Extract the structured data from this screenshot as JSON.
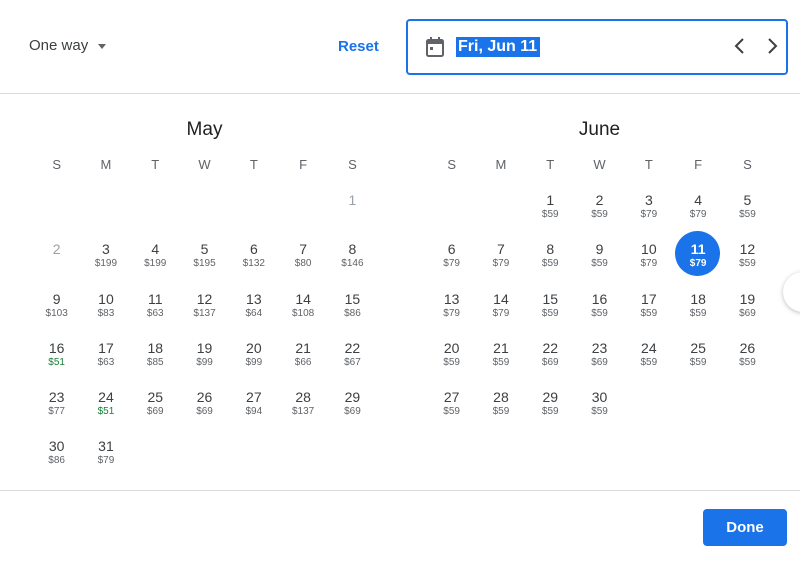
{
  "header": {
    "trip_type": "One way",
    "reset_label": "Reset",
    "selected_date": "Fri, Jun 11"
  },
  "weekdays": [
    "S",
    "M",
    "T",
    "W",
    "T",
    "F",
    "S"
  ],
  "months": [
    {
      "name": "May",
      "days": [
        {
          "day": "",
          "price": ""
        },
        {
          "day": "",
          "price": ""
        },
        {
          "day": "",
          "price": ""
        },
        {
          "day": "",
          "price": ""
        },
        {
          "day": "",
          "price": ""
        },
        {
          "day": "",
          "price": ""
        },
        {
          "day": "1",
          "price": "",
          "muted": true
        },
        {
          "day": "2",
          "price": "",
          "muted": true
        },
        {
          "day": "3",
          "price": "$199"
        },
        {
          "day": "4",
          "price": "$199"
        },
        {
          "day": "5",
          "price": "$195"
        },
        {
          "day": "6",
          "price": "$132"
        },
        {
          "day": "7",
          "price": "$80"
        },
        {
          "day": "8",
          "price": "$146"
        },
        {
          "day": "9",
          "price": "$103"
        },
        {
          "day": "10",
          "price": "$83"
        },
        {
          "day": "11",
          "price": "$63"
        },
        {
          "day": "12",
          "price": "$137"
        },
        {
          "day": "13",
          "price": "$64"
        },
        {
          "day": "14",
          "price": "$108"
        },
        {
          "day": "15",
          "price": "$86"
        },
        {
          "day": "16",
          "price": "$51",
          "low": true
        },
        {
          "day": "17",
          "price": "$63"
        },
        {
          "day": "18",
          "price": "$85"
        },
        {
          "day": "19",
          "price": "$99"
        },
        {
          "day": "20",
          "price": "$99"
        },
        {
          "day": "21",
          "price": "$66"
        },
        {
          "day": "22",
          "price": "$67"
        },
        {
          "day": "23",
          "price": "$77"
        },
        {
          "day": "24",
          "price": "$51",
          "low": true
        },
        {
          "day": "25",
          "price": "$69"
        },
        {
          "day": "26",
          "price": "$69"
        },
        {
          "day": "27",
          "price": "$94"
        },
        {
          "day": "28",
          "price": "$137"
        },
        {
          "day": "29",
          "price": "$69"
        },
        {
          "day": "30",
          "price": "$86"
        },
        {
          "day": "31",
          "price": "$79"
        }
      ]
    },
    {
      "name": "June",
      "days": [
        {
          "day": "",
          "price": ""
        },
        {
          "day": "",
          "price": ""
        },
        {
          "day": "1",
          "price": "$59"
        },
        {
          "day": "2",
          "price": "$59"
        },
        {
          "day": "3",
          "price": "$79"
        },
        {
          "day": "4",
          "price": "$79"
        },
        {
          "day": "5",
          "price": "$59"
        },
        {
          "day": "6",
          "price": "$79"
        },
        {
          "day": "7",
          "price": "$79"
        },
        {
          "day": "8",
          "price": "$59"
        },
        {
          "day": "9",
          "price": "$59"
        },
        {
          "day": "10",
          "price": "$79"
        },
        {
          "day": "11",
          "price": "$79",
          "selected": true
        },
        {
          "day": "12",
          "price": "$59"
        },
        {
          "day": "13",
          "price": "$79"
        },
        {
          "day": "14",
          "price": "$79"
        },
        {
          "day": "15",
          "price": "$59"
        },
        {
          "day": "16",
          "price": "$59"
        },
        {
          "day": "17",
          "price": "$59"
        },
        {
          "day": "18",
          "price": "$59"
        },
        {
          "day": "19",
          "price": "$69"
        },
        {
          "day": "20",
          "price": "$59"
        },
        {
          "day": "21",
          "price": "$59"
        },
        {
          "day": "22",
          "price": "$69"
        },
        {
          "day": "23",
          "price": "$69"
        },
        {
          "day": "24",
          "price": "$59"
        },
        {
          "day": "25",
          "price": "$59"
        },
        {
          "day": "26",
          "price": "$59"
        },
        {
          "day": "27",
          "price": "$59"
        },
        {
          "day": "28",
          "price": "$59"
        },
        {
          "day": "29",
          "price": "$59"
        },
        {
          "day": "30",
          "price": "$59"
        }
      ]
    }
  ],
  "footer": {
    "done_label": "Done"
  },
  "icons": {
    "calendar": "calendar-icon",
    "prev": "chevron-left-icon",
    "next": "chevron-right-icon",
    "dropdown": "caret-down-icon"
  },
  "colors": {
    "accent": "#1a73e8",
    "low_price": "#188038"
  }
}
